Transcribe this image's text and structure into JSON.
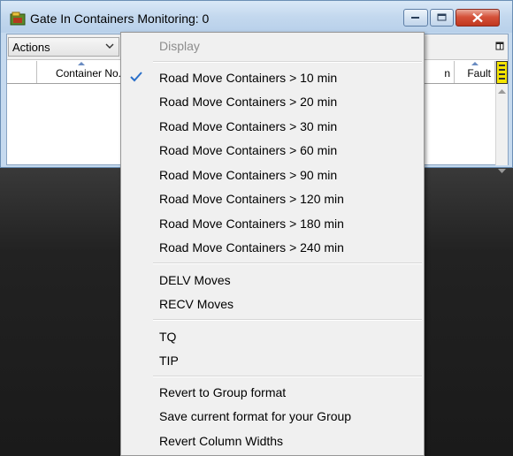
{
  "window": {
    "title": "Gate In Containers Monitoring: 0"
  },
  "toolbar": {
    "actions_label": "Actions"
  },
  "grid": {
    "columns": [
      "Container No.",
      "n",
      "Fault"
    ]
  },
  "menu": {
    "header": "Display",
    "road_moves": [
      "Road Move Containers > 10 min",
      "Road Move Containers > 20 min",
      "Road Move Containers > 30 min",
      "Road Move Containers > 60 min",
      "Road Move Containers > 90 min",
      "Road Move Containers > 120 min",
      "Road Move Containers > 180 min",
      "Road Move Containers > 240 min"
    ],
    "checked_item": "Road Move Containers > 10 min",
    "moves": [
      "DELV Moves",
      "RECV Moves"
    ],
    "t_items": [
      "TQ",
      "TIP"
    ],
    "format_items": [
      "Revert to Group format",
      "Save current format for your Group",
      "Revert Column Widths"
    ]
  },
  "colors": {
    "title_bar": "#c3d8ee",
    "close_button": "#c0381f",
    "menu_background": "#f0f0f0",
    "check_color": "#2a6fc9",
    "disabled_text": "#8d8d8d",
    "indicator_yellow": "#f4e400"
  }
}
